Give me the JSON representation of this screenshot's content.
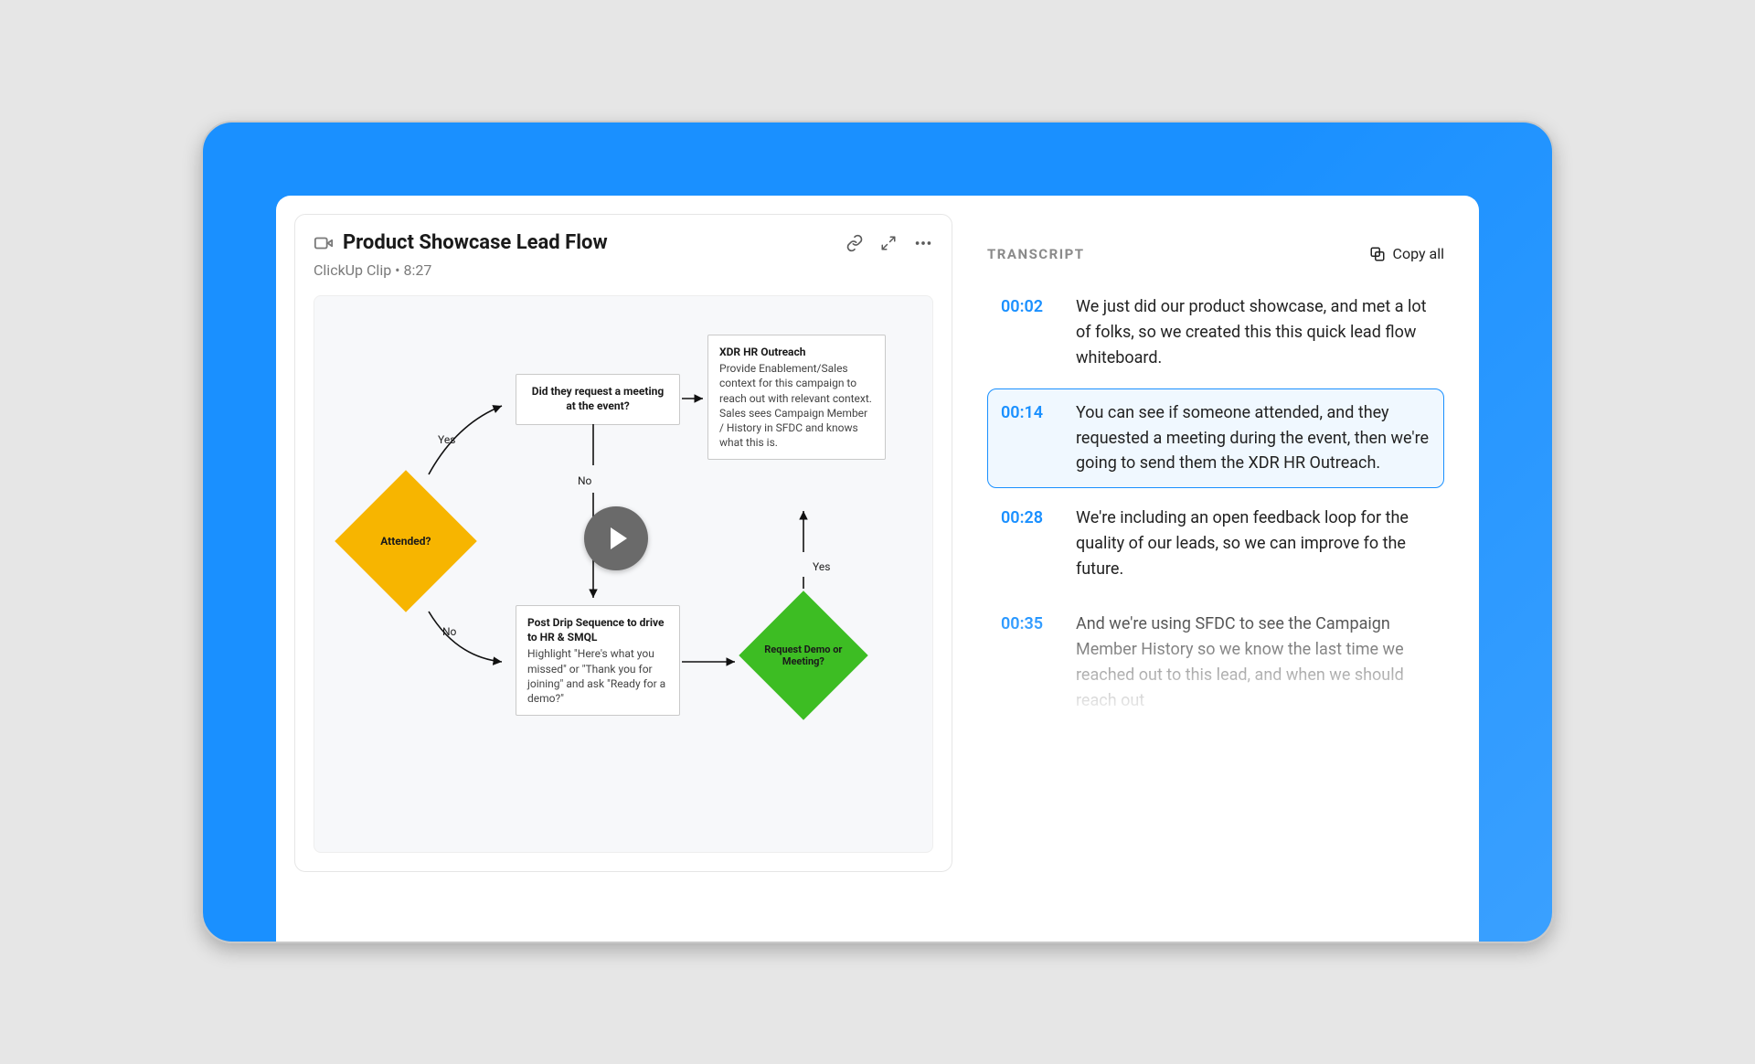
{
  "clip": {
    "title": "Product Showcase Lead Flow",
    "source": "ClickUp Clip",
    "duration": "8:27",
    "subtitle_combined": "ClickUp Clip  •  8:27"
  },
  "actions": {
    "link_tooltip": "Copy link",
    "expand_tooltip": "Expand",
    "more_tooltip": "More"
  },
  "flow": {
    "attended_label": "Attended?",
    "yes_label_top": "Yes",
    "no_label_bottom": "No",
    "meeting_box": "Did they request a meeting at the event?",
    "no_label_mid": "No",
    "xdr_title": "XDR HR Outreach",
    "xdr_body": "Provide Enablement/Sales context for this campaign to reach out with relevant context. Sales sees Campaign Member / History in SFDC and knows what this is.",
    "post_title": "Post Drip Sequence to drive to HR & SMQL",
    "post_body": "Highlight \"Here's what you missed\" or \"Thank you for joining\" and ask \"Ready for a demo?\"",
    "request_label": "Request Demo or Meeting?",
    "yes_label_right": "Yes"
  },
  "transcript": {
    "heading": "TRANSCRIPT",
    "copy_all_label": "Copy all",
    "rows": [
      {
        "time": "00:02",
        "text": "We just did our product showcase, and met a lot of folks, so we created this this quick lead flow whiteboard.",
        "active": false
      },
      {
        "time": "00:14",
        "text": "You can see if someone attended, and they requested a meeting during the event, then we're going to send them the XDR HR Outreach.",
        "active": true
      },
      {
        "time": "00:28",
        "text": "We're including an open feedback loop for the quality of our leads, so we can improve fo the future.",
        "active": false
      },
      {
        "time": "00:35",
        "text": "And we're using SFDC to see the Campaign Member History so we know the last time we reached out to this lead, and when we should reach out",
        "active": false,
        "fadeout": true
      }
    ]
  }
}
